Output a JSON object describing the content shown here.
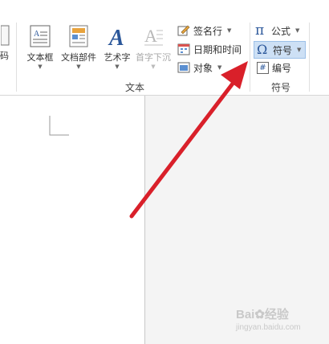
{
  "ribbon": {
    "text_group": {
      "label": "文本",
      "partial_label": "码",
      "buttons": [
        {
          "label": "文本框"
        },
        {
          "label": "文档部件"
        },
        {
          "label": "艺术字"
        },
        {
          "label": "首字下沉"
        }
      ],
      "small_buttons": [
        {
          "label": "签名行",
          "icon": "signature-line-icon"
        },
        {
          "label": "日期和时间",
          "icon": "calendar-icon"
        },
        {
          "label": "对象",
          "icon": "object-icon"
        }
      ]
    },
    "symbols_group": {
      "label": "符号",
      "items": [
        {
          "label": "公式",
          "icon": "pi-icon",
          "glyph": "π"
        },
        {
          "label": "符号",
          "icon": "omega-icon",
          "glyph": "Ω"
        },
        {
          "label": "编号",
          "icon": "number-icon",
          "glyph": "#"
        }
      ]
    }
  },
  "watermark": {
    "brand": "Bai",
    "brand_tail": "经验",
    "url": "jingyan.baidu.com"
  },
  "colors": {
    "accent_blue": "#2b579a",
    "arrow_red": "#d9202a",
    "highlight": "#cde0f5"
  }
}
